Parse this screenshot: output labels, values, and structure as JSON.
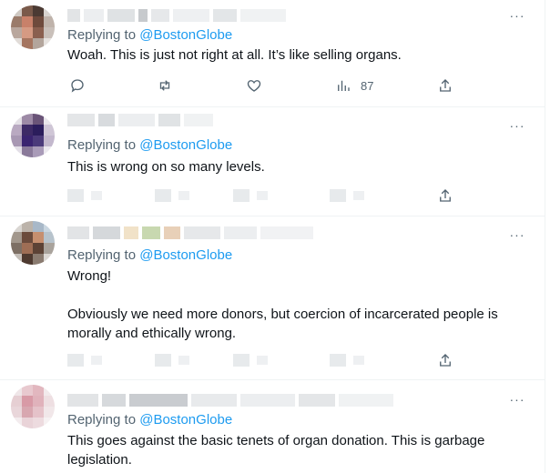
{
  "tweets": [
    {
      "replying_prefix": "Replying to",
      "handle": "@BostonGlobe",
      "text": [
        "Woah. This is just not right at all. It’s like selling organs."
      ],
      "more": "···",
      "views": "87"
    },
    {
      "replying_prefix": "Replying to",
      "handle": "@BostonGlobe",
      "text": [
        "This is wrong on so many levels."
      ],
      "more": "···"
    },
    {
      "replying_prefix": "Replying to",
      "handle": "@BostonGlobe",
      "text": [
        "Wrong!",
        "Obviously we need more donors, but coercion of incarcerated people is morally and ethically wrong."
      ],
      "more": "···"
    },
    {
      "replying_prefix": "Replying to",
      "handle": "@BostonGlobe",
      "text": [
        "This goes against the basic tenets of organ donation. This is garbage legislation."
      ],
      "more": "···"
    }
  ],
  "icons": {
    "reply": "reply-icon",
    "retweet": "retweet-icon",
    "like": "heart-icon",
    "views": "views-icon",
    "share": "share-icon",
    "more": "more-icon"
  },
  "colors": {
    "link": "#1d9bf0",
    "secondary_text": "#536471",
    "text": "#0f1419",
    "divider": "#eff3f4"
  }
}
